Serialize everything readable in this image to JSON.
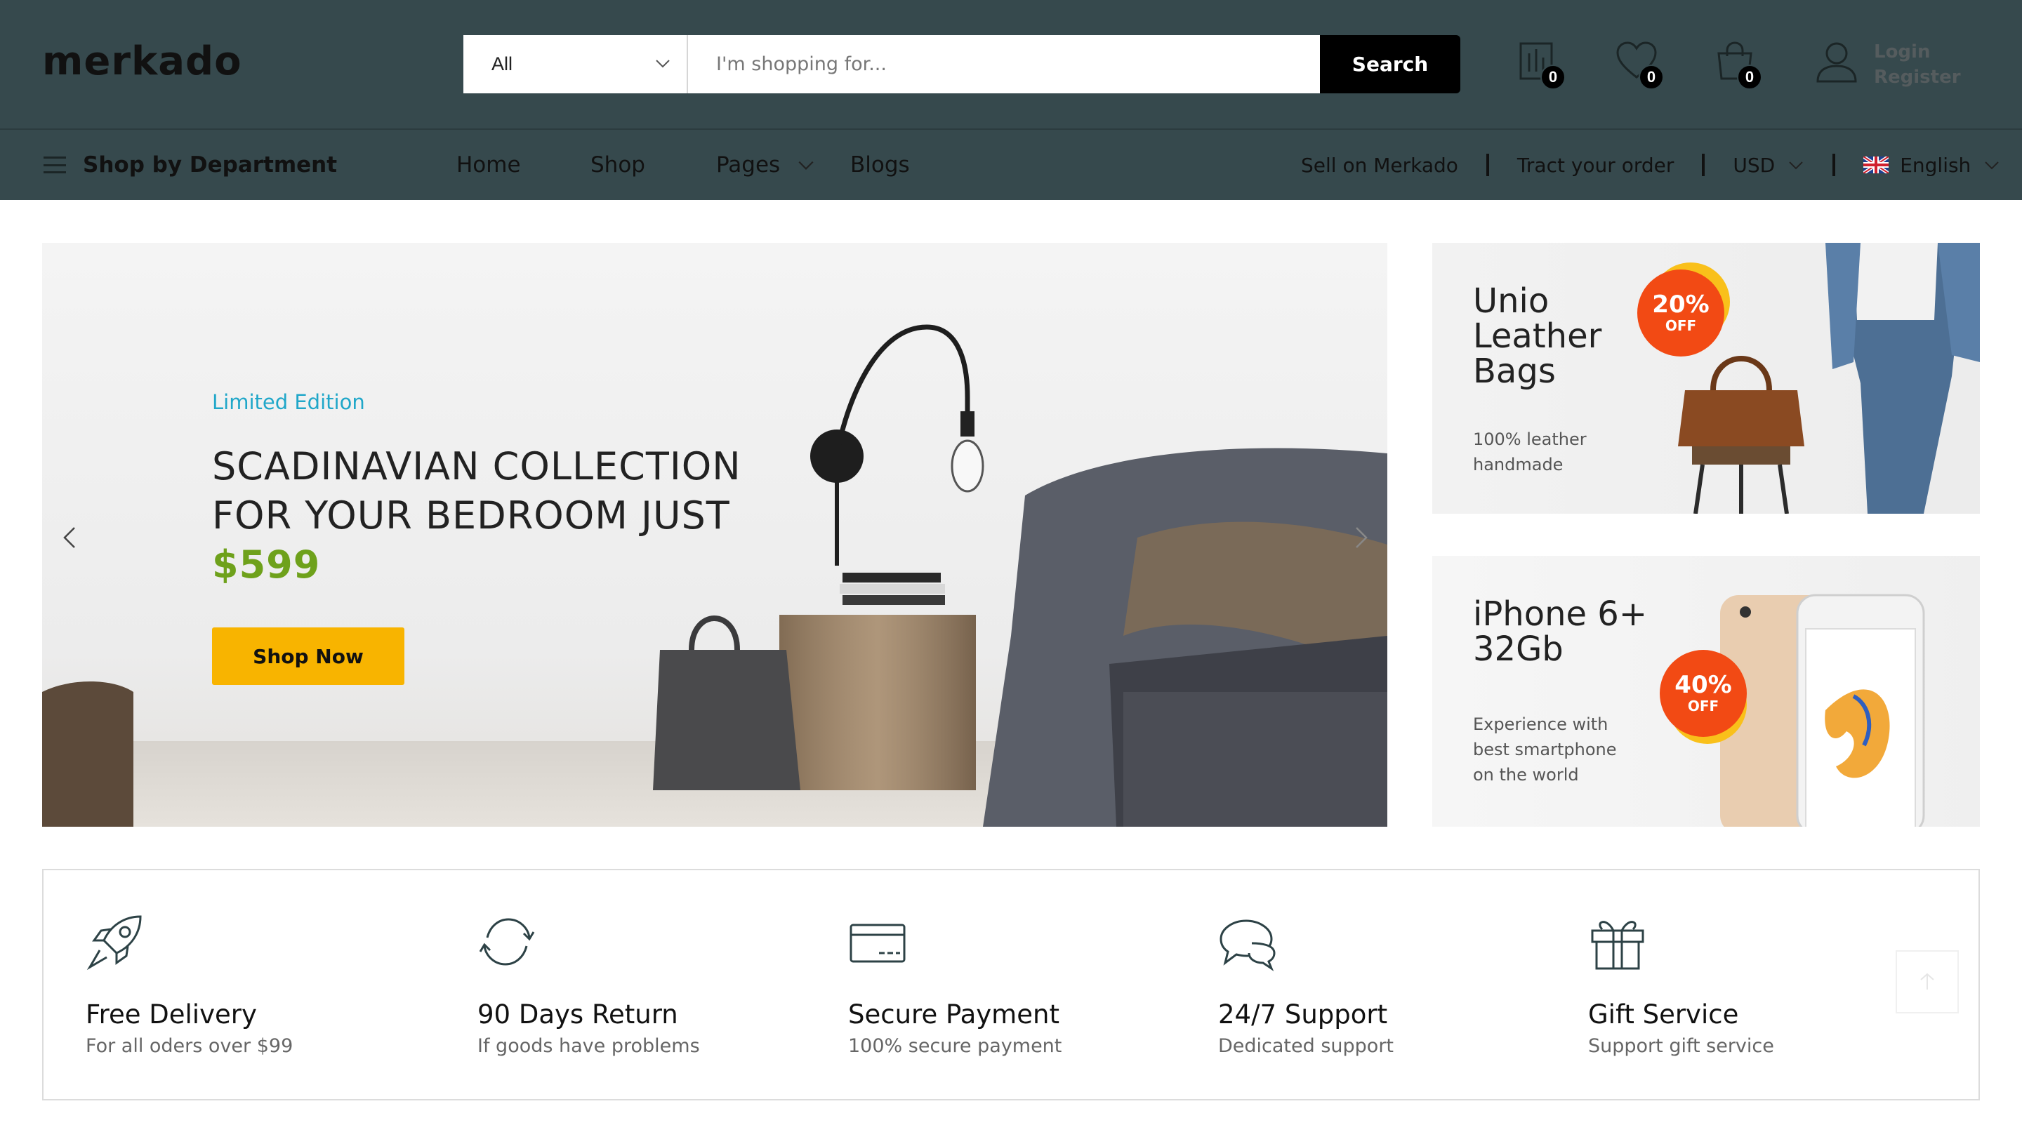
{
  "header": {
    "logo": "merkado",
    "search": {
      "category": "All",
      "placeholder": "I'm shopping for...",
      "button": "Search"
    },
    "counters": {
      "compare": "0",
      "wishlist": "0",
      "cart": "0"
    },
    "account": {
      "login": "Login",
      "register": "Register"
    },
    "icons": [
      "compare-icon",
      "heart-icon",
      "cart-icon",
      "user-icon"
    ]
  },
  "nav": {
    "department": "Shop by Department",
    "menu": {
      "home": "Home",
      "shop": "Shop",
      "pages": "Pages",
      "blogs": "Blogs"
    },
    "right": {
      "sell": "Sell on Merkado",
      "track": "Tract your order",
      "currency": "USD",
      "language": "English"
    }
  },
  "hero": {
    "eyebrow": "Limited Edition",
    "title": "SCADINAVIAN COLLECTION FOR YOUR BEDROOM JUST",
    "price": "$599",
    "button": "Shop Now"
  },
  "promos": [
    {
      "title": "Unio Leather Bags",
      "subtitle": "100% leather handmade",
      "percent": "20%",
      "off": "OFF"
    },
    {
      "title": "iPhone 6+ 32Gb",
      "subtitle": "Experience with best smartphone on the world",
      "percent": "40%",
      "off": "OFF"
    }
  ],
  "features": [
    {
      "icon": "rocket-icon",
      "title": "Free Delivery",
      "subtitle": "For all oders over $99"
    },
    {
      "icon": "return-icon",
      "title": "90 Days Return",
      "subtitle": "If goods have problems"
    },
    {
      "icon": "credit-card-icon",
      "title": "Secure Payment",
      "subtitle": "100% secure payment"
    },
    {
      "icon": "chat-icon",
      "title": "24/7 Support",
      "subtitle": "Dedicated support"
    },
    {
      "icon": "gift-icon",
      "title": "Gift Service",
      "subtitle": "Support gift service"
    }
  ],
  "colors": {
    "header_bg": "#36494d",
    "accent_cyan": "#20a7c9",
    "price_green": "#6ea11b",
    "button_yellow": "#f8b400",
    "badge_orange": "#f24a14"
  }
}
